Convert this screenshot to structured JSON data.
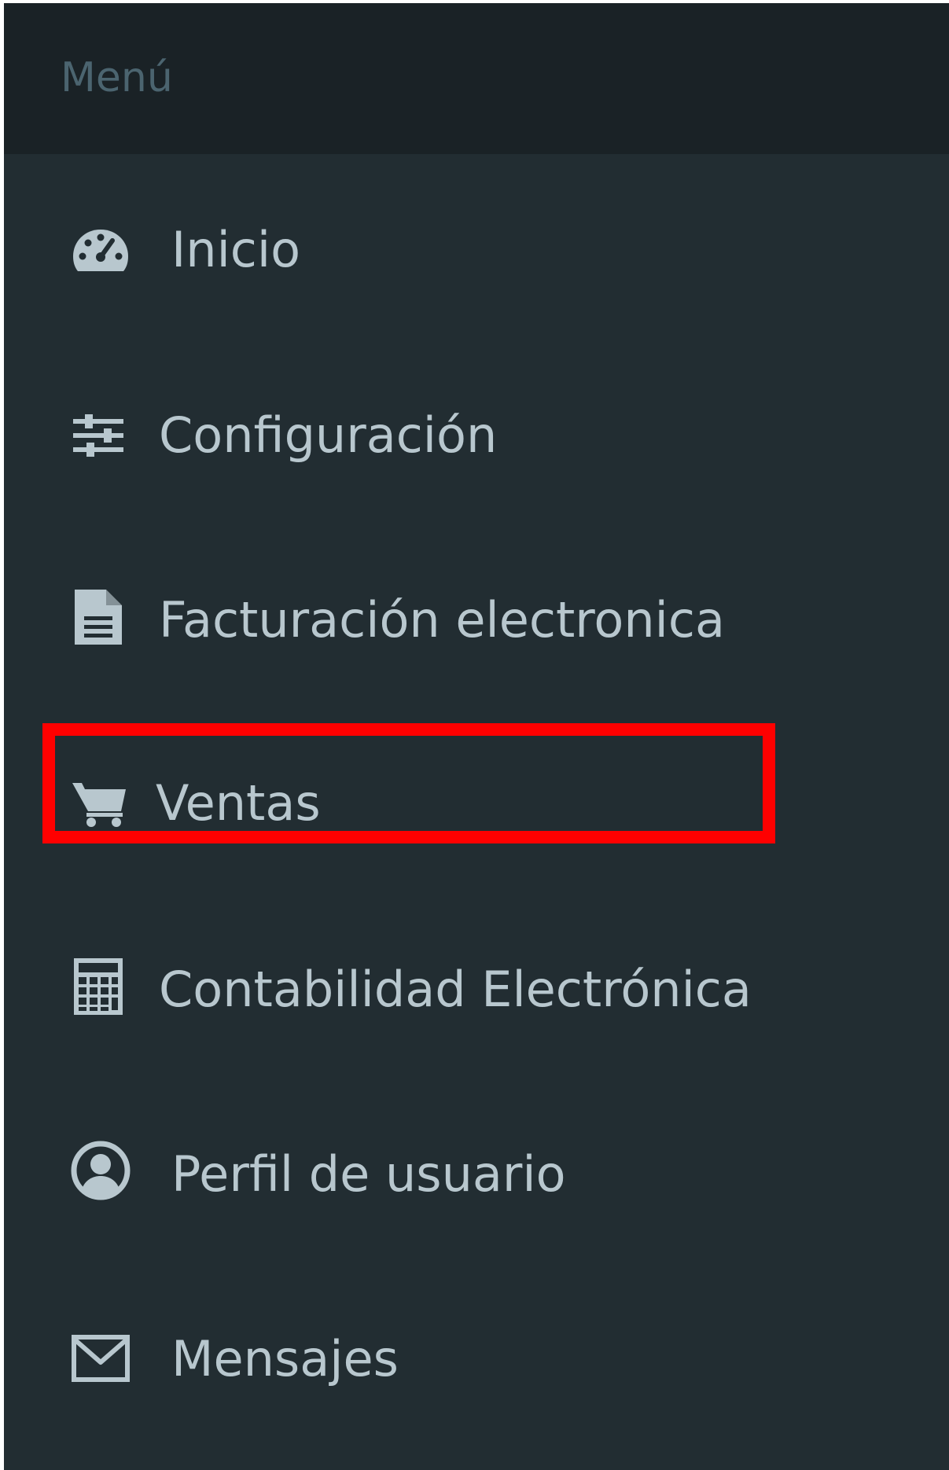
{
  "sidebar": {
    "header_title": "Menú",
    "items": [
      {
        "label": "Inicio",
        "icon": "dashboard-icon"
      },
      {
        "label": "Configuración",
        "icon": "sliders-icon"
      },
      {
        "label": "Facturación electronica",
        "icon": "file-text-icon"
      },
      {
        "label": "Ventas",
        "icon": "shopping-cart-icon"
      },
      {
        "label": "Contabilidad Electrónica",
        "icon": "calculator-icon"
      },
      {
        "label": "Perfil de usuario",
        "icon": "user-circle-icon"
      },
      {
        "label": "Mensajes",
        "icon": "envelope-icon"
      }
    ],
    "highlighted_item": "Ventas"
  },
  "colors": {
    "sidebar_bg": "#222d32",
    "header_bg": "#1a2226",
    "header_text": "#4b646f",
    "item_text": "#b8c7ce",
    "highlight_border": "#ff0000"
  }
}
